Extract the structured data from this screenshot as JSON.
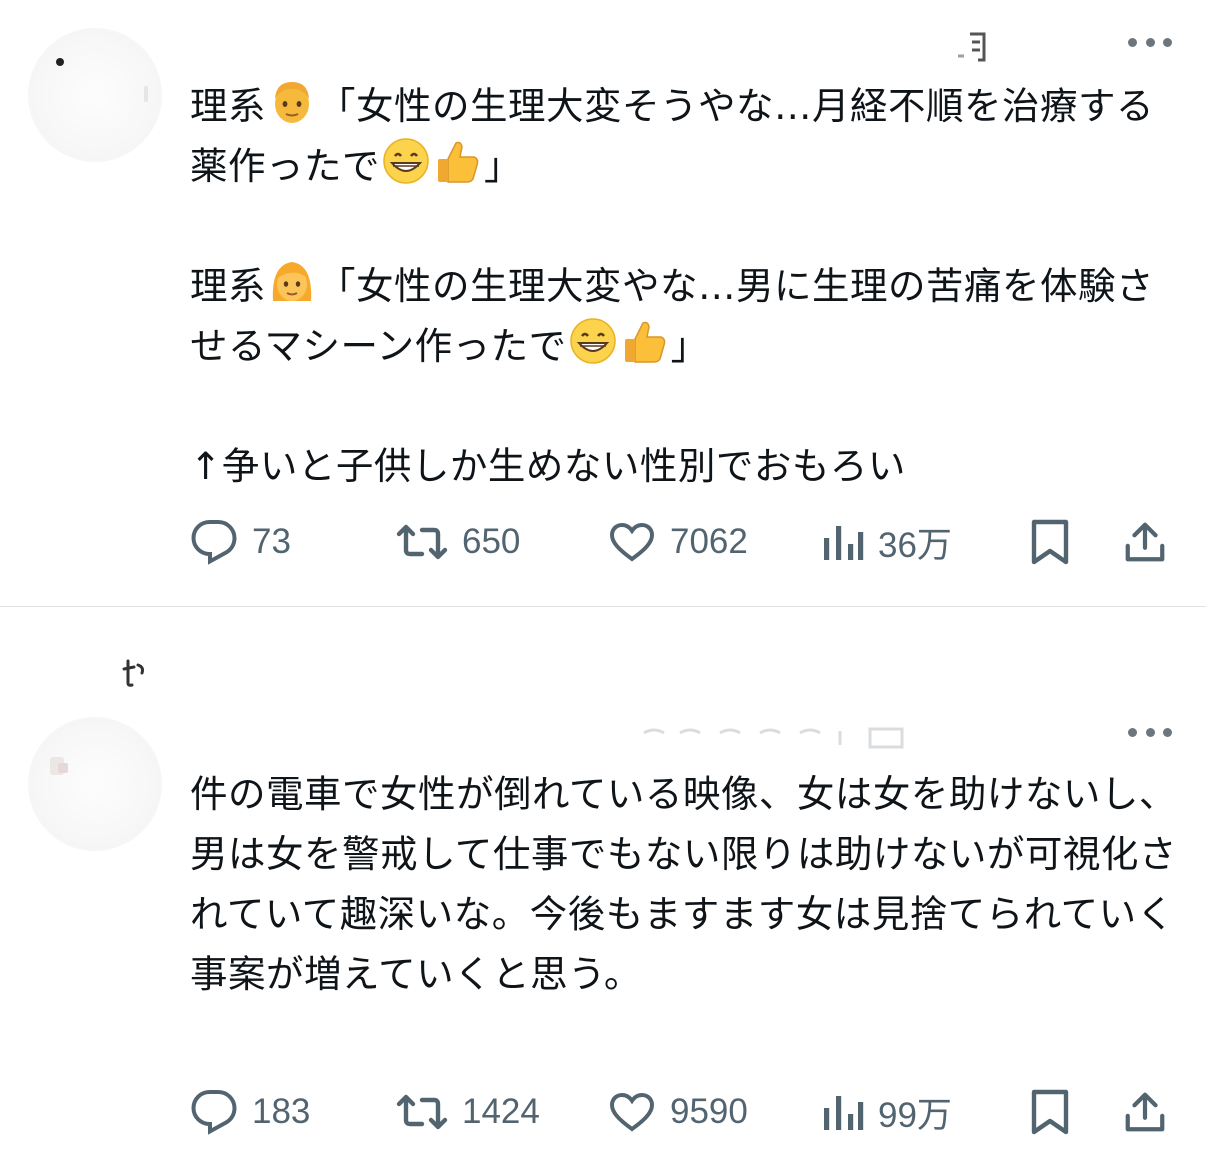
{
  "tweets": [
    {
      "text_parts": [
        "理系",
        "「女性の生理大変そうやな…月経不順を治療する薬作ったで",
        "」\n\n理系",
        "「女性の生理大変やな…男に生理の苦痛を体験させるマシーン作ったで",
        "」\n\n↑争いと子供しか生めない性別でおもろい"
      ],
      "emojis": [
        "man-emoji",
        "grinning-emoji",
        "thumbs-up-emoji",
        "woman-emoji",
        "grinning-emoji",
        "thumbs-up-emoji"
      ],
      "actions": {
        "reply": "73",
        "retweet": "650",
        "like": "7062",
        "views": "36万"
      }
    },
    {
      "text": "件の電車で女性が倒れている映像、女は女を助けないし、男は女を警戒して仕事でもない限りは助けないが可視化されていて趣深いな。今後もますます女は見捨てられていく事案が増えていくと思う。",
      "actions": {
        "reply": "183",
        "retweet": "1424",
        "like": "9590",
        "views": "99万"
      }
    }
  ],
  "colors": {
    "text": "#0f1419",
    "muted": "#536471",
    "divider": "#dfe3e6"
  },
  "icons": [
    "reply-icon",
    "retweet-icon",
    "like-icon",
    "views-icon",
    "bookmark-icon",
    "share-icon",
    "more-icon"
  ]
}
